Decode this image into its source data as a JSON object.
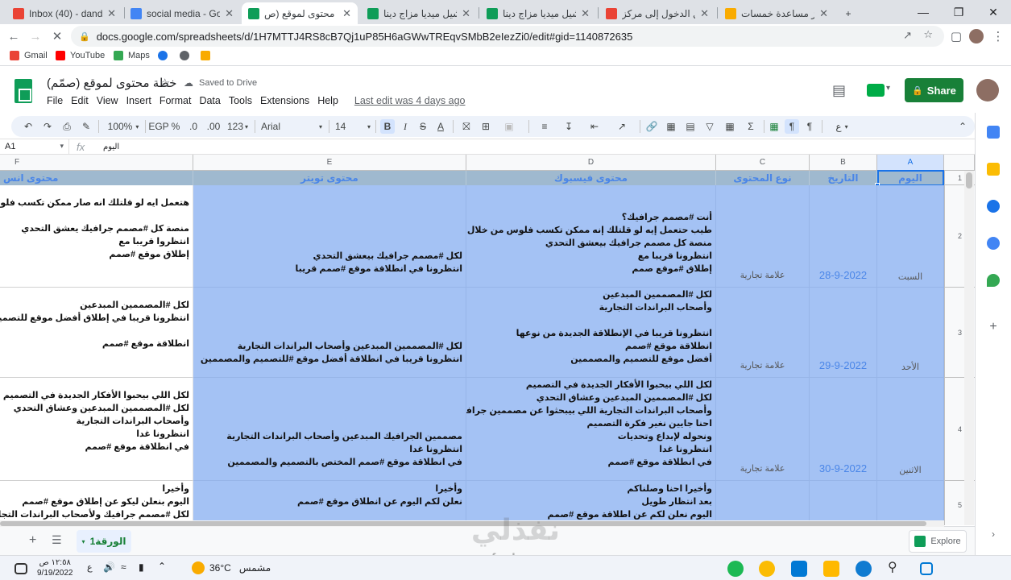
{
  "browser": {
    "tabs": [
      {
        "title": "Inbox (40) - dandona...",
        "favicon_color": "#ea4335",
        "active": false
      },
      {
        "title": "social media - Google...",
        "favicon_color": "#4285f4",
        "active": false
      },
      {
        "title": "خطة محتوى لموقع (ص...",
        "favicon_color": "#0f9d58",
        "active": true
      },
      {
        "title": "سوشيل ميديا مزاج دينا...",
        "favicon_color": "#0f9d58",
        "active": false
      },
      {
        "title": "سوشيل ميديا مزاج دينا...",
        "favicon_color": "#0f9d58",
        "active": false
      },
      {
        "title": "تسجيل الدخول إلى مركز...",
        "favicon_color": "#ea4335",
        "active": false
      },
      {
        "title": "مركز مساعدة خمسات",
        "favicon_color": "#f9ab00",
        "active": false
      }
    ],
    "new_tab_label": "+",
    "url": "docs.google.com/spreadsheets/d/1H7MTTJ4RS8cB7Qj1uP85H6aGWwTREqvSMbB2eIezZi0/edit#gid=1140872635",
    "bookmarks": [
      {
        "label": "Gmail",
        "color": "#ea4335"
      },
      {
        "label": "YouTube",
        "color": "#ff0000"
      },
      {
        "label": "Maps",
        "color": "#34a853"
      }
    ]
  },
  "doc": {
    "title": "خطة محتوى لموقع (صمّم)",
    "saved_status": "Saved to Drive",
    "menus": [
      "File",
      "Edit",
      "View",
      "Insert",
      "Format",
      "Data",
      "Tools",
      "Extensions",
      "Help"
    ],
    "last_edit": "Last edit was 4 days ago",
    "share_label": "Share",
    "accent_color": "#188038"
  },
  "toolbar": {
    "zoom": "100%",
    "currency": "EGP",
    "percent": "%",
    "decrease_decimal": ".0",
    "increase_decimal": ".00",
    "more_formats": "123",
    "font": "Arial",
    "font_size": "14"
  },
  "formula_bar": {
    "cell_ref": "A1",
    "fx": "fx",
    "value": "اليوم"
  },
  "sheet": {
    "columns": [
      "A",
      "B",
      "C",
      "D",
      "E",
      "F"
    ],
    "header_row": {
      "A": "اليوم",
      "B": "التاريخ",
      "C": "نوع المحتوى",
      "D": "محتوى فيسبوك",
      "E": "محتوى تويتر",
      "F": "محتوى انس"
    },
    "row_numbers": [
      "1",
      "2",
      "3",
      "4",
      "5"
    ],
    "rows": [
      {
        "day": "السبت",
        "date": "28-9-2022",
        "type": "علامة تجارية",
        "facebook": [
          "أنت #مصمم جرافيك؟",
          "طيب حتعمل إيه لو قلتلك إنه ممكن تكسب فلوس من خلال التحديات؟",
          "منصة كل مصمم جرافيك بيعشق التحدي",
          "انتظرونا قريبا مع",
          "إطلاق #موقع صمم"
        ],
        "twitter": [
          "لكل #مصمم جرافيك بيعشق التحدي",
          "انتظرونا في انطلاقة موقع #صمم قريبا"
        ],
        "instagram": [
          "هتعمل ايه لو قلتلك انه صار ممكن تكسب فلوس من خلال التحديات",
          "",
          "منصة كل #مصمم جرافيك يعشق التحدي",
          "انتظروا قريبا مع",
          "إطلاق موقع #صمم"
        ]
      },
      {
        "day": "الأحد",
        "date": "29-9-2022",
        "type": "علامة تجارية",
        "facebook": [
          "لكل #المصممين المبدعين",
          "وأصحاب البراندات التجارية",
          "",
          "انتظرونا قريبا في الإنطلاقة الجديدة من نوعها",
          "انطلاقة موقع #صمم",
          "أفضل موقع للتصميم والمصممين"
        ],
        "twitter": [
          "لكل #المصممين المبدعين وأصحاب البراندات التجارية",
          "انتظرونا قريبا في انطلاقة أفضل موقع #للتصميم والمصممين"
        ],
        "instagram": [
          "لكل #المصممين المبدعين",
          "انتظرونا قريبا في إطلاق أفضل موقع للتصميم و#المصممين",
          "",
          "انطلاقة موقع #صمم"
        ]
      },
      {
        "day": "الاثنين",
        "date": "30-9-2022",
        "type": "علامة تجارية",
        "facebook": [
          "لكل اللي بيحبوا الأفكار الجديدة في التصميم",
          "لكل #المصممين المبدعين وعشاق التحدي",
          "وأصحاب البراندات التجارية اللي بيبحثوا عن مصممين جرافيك احترافيين",
          "احنا جايين نغير فكرة التصميم",
          "ونحوله لإبداع وتحديات",
          "انتظرونا غدا",
          "في انطلاقة موقع #صمم"
        ],
        "twitter": [
          "مصممين الجرافيك المبدعين وأصحاب البراندات التجارية",
          "انتظرونا غدا",
          "في انطلاقة موقع #صمم المختص بالتصميم والمصممين"
        ],
        "instagram": [
          "لكل اللي بيحبوا الأفكار الجديدة في التصميم",
          "لكل #المصممين المبدعين وعشاق التحدي",
          "وأصحاب البراندات التجارية",
          "انتظرونا غدا",
          "في انطلاقة موقع #صمم"
        ]
      },
      {
        "day": "",
        "date": "",
        "type": "",
        "facebook": [
          "وأخيرا احنا وصلناكم",
          "بعد انتظار طويل",
          "اليوم نعلن لكم عن اطلاقة موقع #صمم"
        ],
        "twitter": [
          "وأخيرا",
          "نعلن لكم اليوم عن انطلاق موقع #صمم"
        ],
        "instagram": [
          "وأخيرا",
          "اليوم بنعلن ليكو عن إطلاق موقع #صمم",
          "لكل #مصمم جرافيك ولأصحاب البراندات التجارية"
        ]
      }
    ],
    "sheet_tab": "الورقة1",
    "explore_label": "Explore",
    "header_fill": "#9fb9cf",
    "body_fill": "#a4c2f4"
  },
  "taskbar": {
    "time": "١٢:٥٨ ص",
    "date": "9/19/2022",
    "temperature": "36°C",
    "weather": "مشمس",
    "lang": "ع"
  },
  "watermark": {
    "arabic": "نفذلي",
    "latin": "nafezly.com"
  }
}
